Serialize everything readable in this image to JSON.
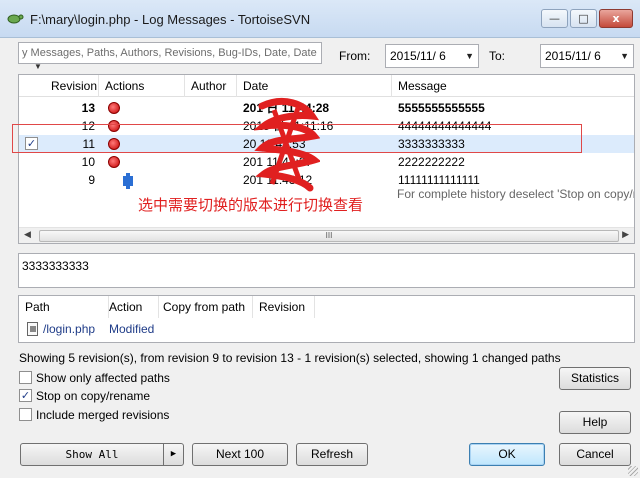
{
  "window": {
    "title": "F:\\mary\\login.php - Log Messages - TortoiseSVN",
    "minimize": "—",
    "maximize": "□",
    "close": "x"
  },
  "filter": {
    "placeholder": "y Messages, Paths, Authors, Revisions, Bug-IDs, Date, Date",
    "from_label": "From:",
    "from_value": "2015/11/  6",
    "to_label": "To:",
    "to_value": "2015/11/  6"
  },
  "log_columns": [
    "Revision",
    "Actions",
    "Author",
    "Date",
    "Message"
  ],
  "log_rows": [
    {
      "revision": "13",
      "date": "201      日 11:44:28",
      "message": "5555555555555",
      "bold": true,
      "checked": false,
      "selected": false,
      "action": "modified"
    },
    {
      "revision": "12",
      "date": "2015      日 11:11:16",
      "message": "44444444444444",
      "bold": false,
      "checked": false,
      "selected": false,
      "action": "modified"
    },
    {
      "revision": "11",
      "date": "20         11:43:53",
      "message": "3333333333",
      "bold": false,
      "checked": true,
      "selected": true,
      "action": "modified"
    },
    {
      "revision": "10",
      "date": "201         11:43:37",
      "message": "2222222222",
      "bold": false,
      "checked": false,
      "selected": false,
      "action": "modified"
    },
    {
      "revision": "9",
      "date": "201         11:43:12",
      "message": "11111111111111",
      "bold": false,
      "checked": false,
      "selected": false,
      "action": "added"
    }
  ],
  "history_note": "For complete history deselect 'Stop on copy/rena",
  "annotation": "选中需要切换的版本进行切换查看",
  "message_text": "3333333333",
  "path_columns": [
    "Path",
    "Action",
    "Copy from path",
    "Revision"
  ],
  "path_rows": [
    {
      "path": "/login.php",
      "action": "Modified"
    }
  ],
  "status_text": "Showing 5 revision(s), from revision 9 to revision 13 - 1 revision(s) selected, showing 1 changed paths",
  "options": [
    {
      "label": "Show only affected paths",
      "checked": false
    },
    {
      "label": "Stop on copy/rename",
      "checked": true
    },
    {
      "label": "Include merged revisions",
      "checked": false
    }
  ],
  "buttons": {
    "statistics": "Statistics",
    "help": "Help",
    "show_all": "Show All",
    "next_100": "Next 100",
    "refresh": "Refresh",
    "ok": "OK",
    "cancel": "Cancel"
  },
  "scroll_thumb": "III",
  "colors": {
    "selected_row": "#dcebfc",
    "annotation_red": "#e02020"
  }
}
